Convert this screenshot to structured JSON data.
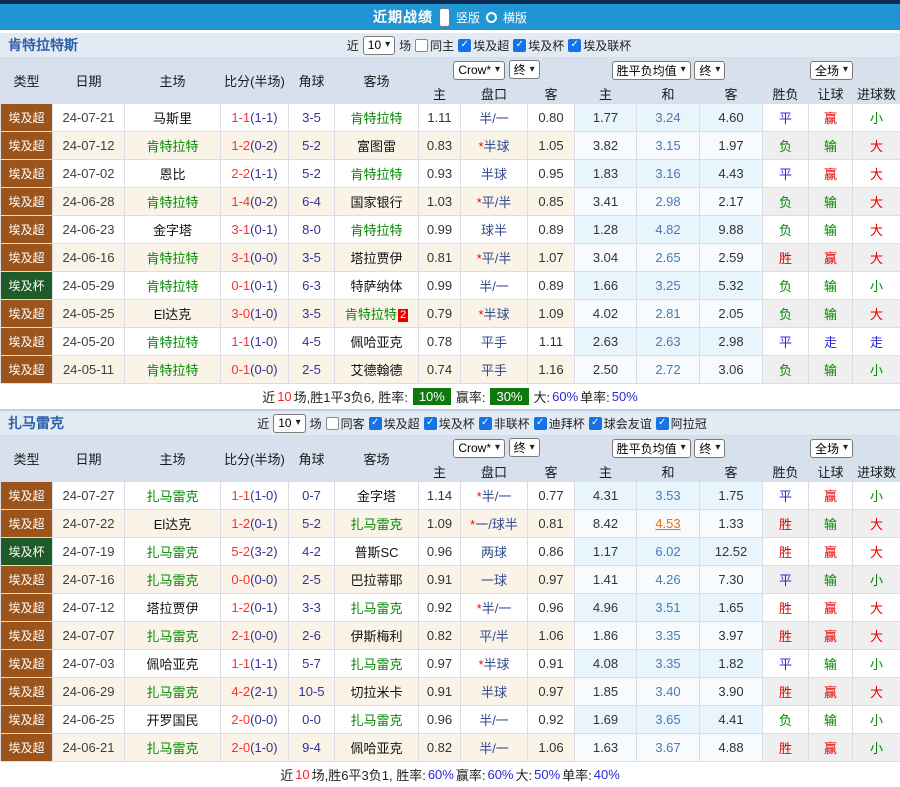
{
  "topbar": {
    "title": "近期战绩",
    "options": [
      {
        "label": "竖版",
        "selected": true
      },
      {
        "label": "横版",
        "selected": false
      }
    ]
  },
  "table_header": {
    "cols": [
      "类型",
      "日期",
      "主场",
      "比分(半场)",
      "角球",
      "客场"
    ],
    "sub": [
      "主",
      "盘口",
      "客",
      "主",
      "和",
      "客",
      "胜负",
      "让球",
      "进球数"
    ],
    "selects": {
      "bookmaker": "Crow*",
      "bookmaker_time": "终",
      "avg": "胜平负均值",
      "avg_time": "终",
      "scope": "全场"
    }
  },
  "sections": [
    {
      "team": "肯特拉特斯",
      "filter": {
        "near": "近",
        "count": "10",
        "unit": "场",
        "same": {
          "label": "同主",
          "checked": false
        },
        "comps": [
          {
            "label": "埃及超",
            "checked": true
          },
          {
            "label": "埃及杯",
            "checked": true
          },
          {
            "label": "埃及联杯",
            "checked": true
          }
        ]
      },
      "rows": [
        {
          "type": "埃及超",
          "cup": false,
          "date": "24-07-21",
          "home": "马斯里",
          "hf": false,
          "score": "1-1",
          "half": "(1-1)",
          "corner": "3-5",
          "away": "肯特拉特",
          "af": true,
          "badge": "",
          "oh": "1.11",
          "hc": "半/一",
          "star": false,
          "oa": "0.80",
          "ah": "1.77",
          "ad": "3.24",
          "aa": "4.60",
          "adc": "",
          "spf": "平",
          "rq": "赢",
          "jq": "小"
        },
        {
          "type": "埃及超",
          "cup": false,
          "date": "24-07-12",
          "home": "肯特拉特",
          "hf": true,
          "score": "1-2",
          "half": "(0-2)",
          "corner": "5-2",
          "away": "富图雷",
          "af": false,
          "badge": "",
          "oh": "0.83",
          "hc": "半球",
          "star": true,
          "oa": "1.05",
          "ah": "3.82",
          "ad": "3.15",
          "aa": "1.97",
          "adc": "",
          "spf": "负",
          "rq": "输",
          "jq": "大"
        },
        {
          "type": "埃及超",
          "cup": false,
          "date": "24-07-02",
          "home": "恩比",
          "hf": false,
          "score": "2-2",
          "half": "(1-1)",
          "corner": "5-2",
          "away": "肯特拉特",
          "af": true,
          "badge": "",
          "oh": "0.93",
          "hc": "半球",
          "star": false,
          "oa": "0.95",
          "ah": "1.83",
          "ad": "3.16",
          "aa": "4.43",
          "adc": "",
          "spf": "平",
          "rq": "赢",
          "jq": "大"
        },
        {
          "type": "埃及超",
          "cup": false,
          "date": "24-06-28",
          "home": "肯特拉特",
          "hf": true,
          "score": "1-4",
          "half": "(0-2)",
          "corner": "6-4",
          "away": "国家银行",
          "af": false,
          "badge": "",
          "oh": "1.03",
          "hc": "平/半",
          "star": true,
          "oa": "0.85",
          "ah": "3.41",
          "ad": "2.98",
          "aa": "2.17",
          "adc": "",
          "spf": "负",
          "rq": "输",
          "jq": "大"
        },
        {
          "type": "埃及超",
          "cup": false,
          "date": "24-06-23",
          "home": "金字塔",
          "hf": false,
          "score": "3-1",
          "half": "(0-1)",
          "corner": "8-0",
          "away": "肯特拉特",
          "af": true,
          "badge": "",
          "oh": "0.99",
          "hc": "球半",
          "star": false,
          "oa": "0.89",
          "ah": "1.28",
          "ad": "4.82",
          "aa": "9.88",
          "adc": "",
          "spf": "负",
          "rq": "输",
          "jq": "大"
        },
        {
          "type": "埃及超",
          "cup": false,
          "date": "24-06-16",
          "home": "肯特拉特",
          "hf": true,
          "score": "3-1",
          "half": "(0-0)",
          "corner": "3-5",
          "away": "塔拉贾伊",
          "af": false,
          "badge": "",
          "oh": "0.81",
          "hc": "平/半",
          "star": true,
          "oa": "1.07",
          "ah": "3.04",
          "ad": "2.65",
          "aa": "2.59",
          "adc": "",
          "spf": "胜",
          "rq": "赢",
          "jq": "大"
        },
        {
          "type": "埃及杯",
          "cup": true,
          "date": "24-05-29",
          "home": "肯特拉特",
          "hf": true,
          "score": "0-1",
          "half": "(0-1)",
          "corner": "6-3",
          "away": "特萨纳体",
          "af": false,
          "badge": "",
          "oh": "0.99",
          "hc": "半/一",
          "star": false,
          "oa": "0.89",
          "ah": "1.66",
          "ad": "3.25",
          "aa": "5.32",
          "adc": "",
          "spf": "负",
          "rq": "输",
          "jq": "小"
        },
        {
          "type": "埃及超",
          "cup": false,
          "date": "24-05-25",
          "home": "El达克",
          "hf": false,
          "score": "3-0",
          "half": "(1-0)",
          "corner": "3-5",
          "away": "肯特拉特",
          "af": true,
          "badge": "2",
          "oh": "0.79",
          "hc": "半球",
          "star": true,
          "oa": "1.09",
          "ah": "4.02",
          "ad": "2.81",
          "aa": "2.05",
          "adc": "",
          "spf": "负",
          "rq": "输",
          "jq": "大"
        },
        {
          "type": "埃及超",
          "cup": false,
          "date": "24-05-20",
          "home": "肯特拉特",
          "hf": true,
          "score": "1-1",
          "half": "(1-0)",
          "corner": "4-5",
          "away": "佩哈亚克",
          "af": false,
          "badge": "",
          "oh": "0.78",
          "hc": "平手",
          "star": false,
          "oa": "1.11",
          "ah": "2.63",
          "ad": "2.63",
          "aa": "2.98",
          "adc": "",
          "spf": "平",
          "rq": "走",
          "jq": "走"
        },
        {
          "type": "埃及超",
          "cup": false,
          "date": "24-05-11",
          "home": "肯特拉特",
          "hf": true,
          "score": "0-1",
          "half": "(0-0)",
          "corner": "2-5",
          "away": "艾德翰德",
          "af": false,
          "badge": "",
          "oh": "0.74",
          "hc": "平手",
          "star": false,
          "oa": "1.16",
          "ah": "2.50",
          "ad": "2.72",
          "aa": "3.06",
          "adc": "",
          "spf": "负",
          "rq": "输",
          "jq": "小"
        }
      ],
      "summary": [
        {
          "t": "近",
          "s": "k"
        },
        {
          "t": "10",
          "s": "r"
        },
        {
          "t": "场,胜1平3负6, 胜率:",
          "s": "k"
        },
        {
          "t": "10%",
          "s": "badge"
        },
        {
          "t": "赢率:",
          "s": "k"
        },
        {
          "t": "30%",
          "s": "badge"
        },
        {
          "t": "大:",
          "s": "k"
        },
        {
          "t": "60%",
          "s": "b"
        },
        {
          "t": " 单率:",
          "s": "k"
        },
        {
          "t": "50%",
          "s": "b"
        }
      ]
    },
    {
      "team": "扎马雷克",
      "filter": {
        "near": "近",
        "count": "10",
        "unit": "场",
        "same": {
          "label": "同客",
          "checked": false
        },
        "comps": [
          {
            "label": "埃及超",
            "checked": true
          },
          {
            "label": "埃及杯",
            "checked": true
          },
          {
            "label": "非联杯",
            "checked": true
          },
          {
            "label": "迪拜杯",
            "checked": true
          },
          {
            "label": "球会友谊",
            "checked": true
          },
          {
            "label": "阿拉冠",
            "checked": true
          }
        ]
      },
      "rows": [
        {
          "type": "埃及超",
          "cup": false,
          "date": "24-07-27",
          "home": "扎马雷克",
          "hf": true,
          "score": "1-1",
          "half": "(1-0)",
          "corner": "0-7",
          "away": "金字塔",
          "af": false,
          "badge": "",
          "oh": "1.14",
          "hc": "半/一",
          "star": true,
          "oa": "0.77",
          "ah": "4.31",
          "ad": "3.53",
          "aa": "1.75",
          "adc": "",
          "spf": "平",
          "rq": "赢",
          "jq": "小"
        },
        {
          "type": "埃及超",
          "cup": false,
          "date": "24-07-22",
          "home": "El达克",
          "hf": false,
          "score": "1-2",
          "half": "(0-1)",
          "corner": "5-2",
          "away": "扎马雷克",
          "af": true,
          "badge": "",
          "oh": "1.09",
          "hc": "一/球半",
          "star": true,
          "oa": "0.81",
          "ah": "8.42",
          "ad": "4.53",
          "aa": "1.33",
          "adc": "orange",
          "spf": "胜",
          "rq": "输",
          "jq": "大"
        },
        {
          "type": "埃及杯",
          "cup": true,
          "date": "24-07-19",
          "home": "扎马雷克",
          "hf": true,
          "score": "5-2",
          "half": "(3-2)",
          "corner": "4-2",
          "away": "普斯SC",
          "af": false,
          "badge": "",
          "oh": "0.96",
          "hc": "两球",
          "star": false,
          "oa": "0.86",
          "ah": "1.17",
          "ad": "6.02",
          "aa": "12.52",
          "adc": "",
          "spf": "胜",
          "rq": "赢",
          "jq": "大"
        },
        {
          "type": "埃及超",
          "cup": false,
          "date": "24-07-16",
          "home": "扎马雷克",
          "hf": true,
          "score": "0-0",
          "half": "(0-0)",
          "corner": "2-5",
          "away": "巴拉蒂耶",
          "af": false,
          "badge": "",
          "oh": "0.91",
          "hc": "一球",
          "star": false,
          "oa": "0.97",
          "ah": "1.41",
          "ad": "4.26",
          "aa": "7.30",
          "adc": "",
          "spf": "平",
          "rq": "输",
          "jq": "小"
        },
        {
          "type": "埃及超",
          "cup": false,
          "date": "24-07-12",
          "home": "塔拉贾伊",
          "hf": false,
          "score": "1-2",
          "half": "(0-1)",
          "corner": "3-3",
          "away": "扎马雷克",
          "af": true,
          "badge": "",
          "oh": "0.92",
          "hc": "半/一",
          "star": true,
          "oa": "0.96",
          "ah": "4.96",
          "ad": "3.51",
          "aa": "1.65",
          "adc": "",
          "spf": "胜",
          "rq": "赢",
          "jq": "大"
        },
        {
          "type": "埃及超",
          "cup": false,
          "date": "24-07-07",
          "home": "扎马雷克",
          "hf": true,
          "score": "2-1",
          "half": "(0-0)",
          "corner": "2-6",
          "away": "伊斯梅利",
          "af": false,
          "badge": "",
          "oh": "0.82",
          "hc": "平/半",
          "star": false,
          "oa": "1.06",
          "ah": "1.86",
          "ad": "3.35",
          "aa": "3.97",
          "adc": "",
          "spf": "胜",
          "rq": "赢",
          "jq": "大"
        },
        {
          "type": "埃及超",
          "cup": false,
          "date": "24-07-03",
          "home": "佩哈亚克",
          "hf": false,
          "score": "1-1",
          "half": "(1-1)",
          "corner": "5-7",
          "away": "扎马雷克",
          "af": true,
          "badge": "",
          "oh": "0.97",
          "hc": "半球",
          "star": true,
          "oa": "0.91",
          "ah": "4.08",
          "ad": "3.35",
          "aa": "1.82",
          "adc": "",
          "spf": "平",
          "rq": "输",
          "jq": "小"
        },
        {
          "type": "埃及超",
          "cup": false,
          "date": "24-06-29",
          "home": "扎马雷克",
          "hf": true,
          "score": "4-2",
          "half": "(2-1)",
          "corner": "10-5",
          "away": "切拉米卡",
          "af": false,
          "badge": "",
          "oh": "0.91",
          "hc": "半球",
          "star": false,
          "oa": "0.97",
          "ah": "1.85",
          "ad": "3.40",
          "aa": "3.90",
          "adc": "",
          "spf": "胜",
          "rq": "赢",
          "jq": "大"
        },
        {
          "type": "埃及超",
          "cup": false,
          "date": "24-06-25",
          "home": "开罗国民",
          "hf": false,
          "score": "2-0",
          "half": "(0-0)",
          "corner": "0-0",
          "away": "扎马雷克",
          "af": true,
          "badge": "",
          "oh": "0.96",
          "hc": "半/一",
          "star": false,
          "oa": "0.92",
          "ah": "1.69",
          "ad": "3.65",
          "aa": "4.41",
          "adc": "",
          "spf": "负",
          "rq": "输",
          "jq": "小"
        },
        {
          "type": "埃及超",
          "cup": false,
          "date": "24-06-21",
          "home": "扎马雷克",
          "hf": true,
          "score": "2-0",
          "half": "(1-0)",
          "corner": "9-4",
          "away": "佩哈亚克",
          "af": false,
          "badge": "",
          "oh": "0.82",
          "hc": "半/一",
          "star": false,
          "oa": "1.06",
          "ah": "1.63",
          "ad": "3.67",
          "aa": "4.88",
          "adc": "",
          "spf": "胜",
          "rq": "赢",
          "jq": "小"
        }
      ],
      "summary": [
        {
          "t": "近",
          "s": "k"
        },
        {
          "t": "10",
          "s": "r"
        },
        {
          "t": "场,胜6平3负1, 胜率:",
          "s": "k"
        },
        {
          "t": "60%",
          "s": "b"
        },
        {
          "t": " 赢率:",
          "s": "k"
        },
        {
          "t": "60%",
          "s": "b"
        },
        {
          "t": " 大:",
          "s": "k"
        },
        {
          "t": "50%",
          "s": "b"
        },
        {
          "t": " 单率:",
          "s": "k"
        },
        {
          "t": "40%",
          "s": "b"
        }
      ]
    }
  ]
}
